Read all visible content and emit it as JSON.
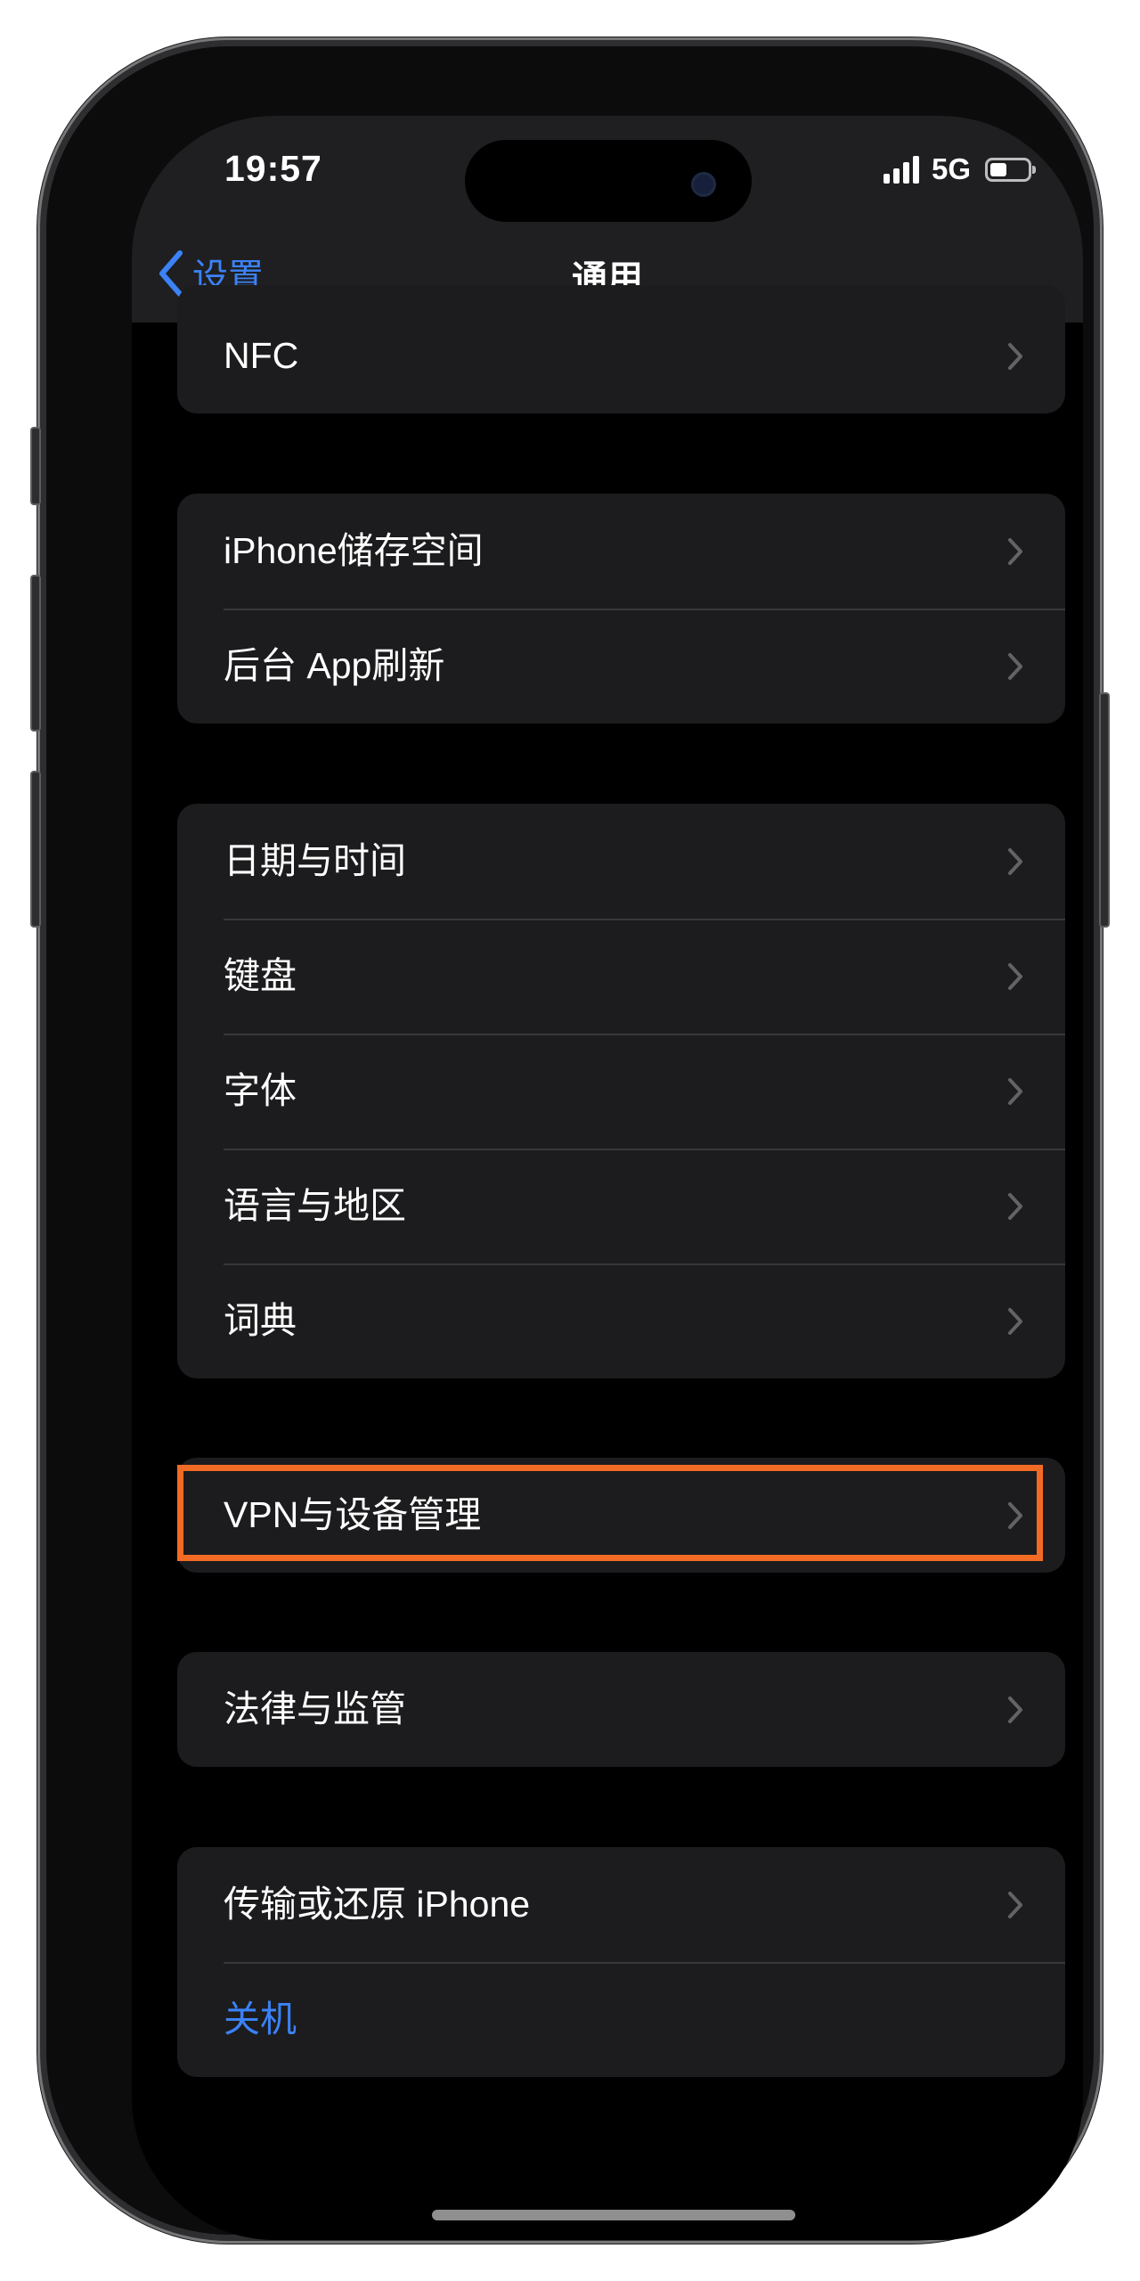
{
  "status_bar": {
    "time": "19:57",
    "network": "5G",
    "signal_bars": 4,
    "battery_level": 0.35
  },
  "nav": {
    "back_label": "设置",
    "title": "通用"
  },
  "groups": [
    {
      "rows": [
        {
          "label": "NFC",
          "chevron": true
        }
      ]
    },
    {
      "rows": [
        {
          "label": "iPhone储存空间",
          "chevron": true
        },
        {
          "label": "后台 App刷新",
          "chevron": true
        }
      ]
    },
    {
      "rows": [
        {
          "label": "日期与时间",
          "chevron": true
        },
        {
          "label": "键盘",
          "chevron": true
        },
        {
          "label": "字体",
          "chevron": true
        },
        {
          "label": "语言与地区",
          "chevron": true
        },
        {
          "label": "词典",
          "chevron": true
        }
      ]
    },
    {
      "rows": [
        {
          "label": "VPN与设备管理",
          "chevron": true
        }
      ]
    },
    {
      "rows": [
        {
          "label": "法律与监管",
          "chevron": true
        }
      ]
    },
    {
      "rows": [
        {
          "label": "传输或还原 iPhone",
          "chevron": true
        },
        {
          "label": "关机",
          "chevron": false,
          "style": "blue"
        }
      ]
    }
  ],
  "colors": {
    "accent_blue": "#3b82f6",
    "highlight_orange": "#f26b24",
    "cell_background": "#1c1c1e",
    "separator": "#38383a"
  }
}
